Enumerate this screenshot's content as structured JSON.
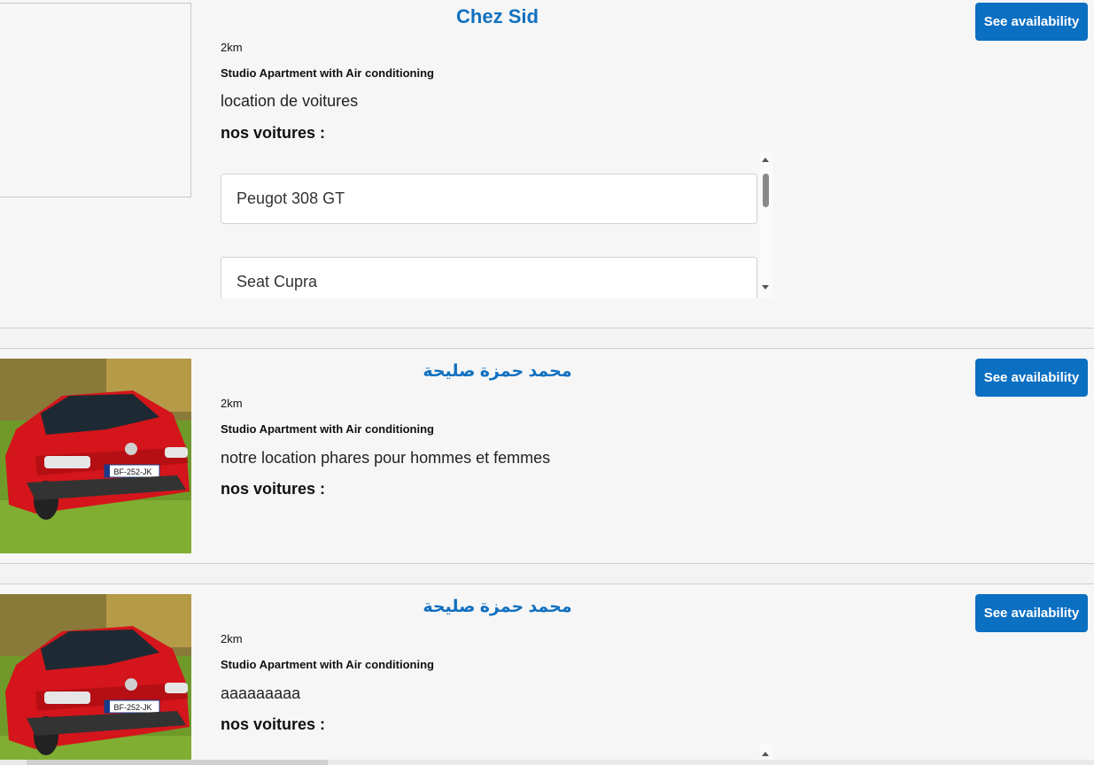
{
  "listings": [
    {
      "title": "Chez Sid",
      "distance": "2km",
      "subtitle": "Studio Apartment with Air conditioning",
      "description": "location de voitures",
      "cars_label": "nos voitures :",
      "cars": [
        "Peugot 308 GT",
        "Seat Cupra"
      ],
      "button": "See availability"
    },
    {
      "title": "محمد حمزة صليحة",
      "distance": "2km",
      "subtitle": "Studio Apartment with Air conditioning",
      "description": "notre location phares pour hommes et femmes",
      "cars_label": "nos voitures :",
      "button": "See availability",
      "photo_plate": "BF-252-JK"
    },
    {
      "title": "محمد حمزة صليحة",
      "distance": "2km",
      "subtitle": "Studio Apartment with Air conditioning",
      "description": "aaaaaaaaa",
      "cars_label": "nos voitures :",
      "button": "See availability",
      "photo_plate": "BF-252-JK"
    }
  ],
  "colors": {
    "title": "#1170c0",
    "button": "#0b6fc2",
    "car_body": "#d4151b",
    "grass": "#6f9a2a"
  }
}
